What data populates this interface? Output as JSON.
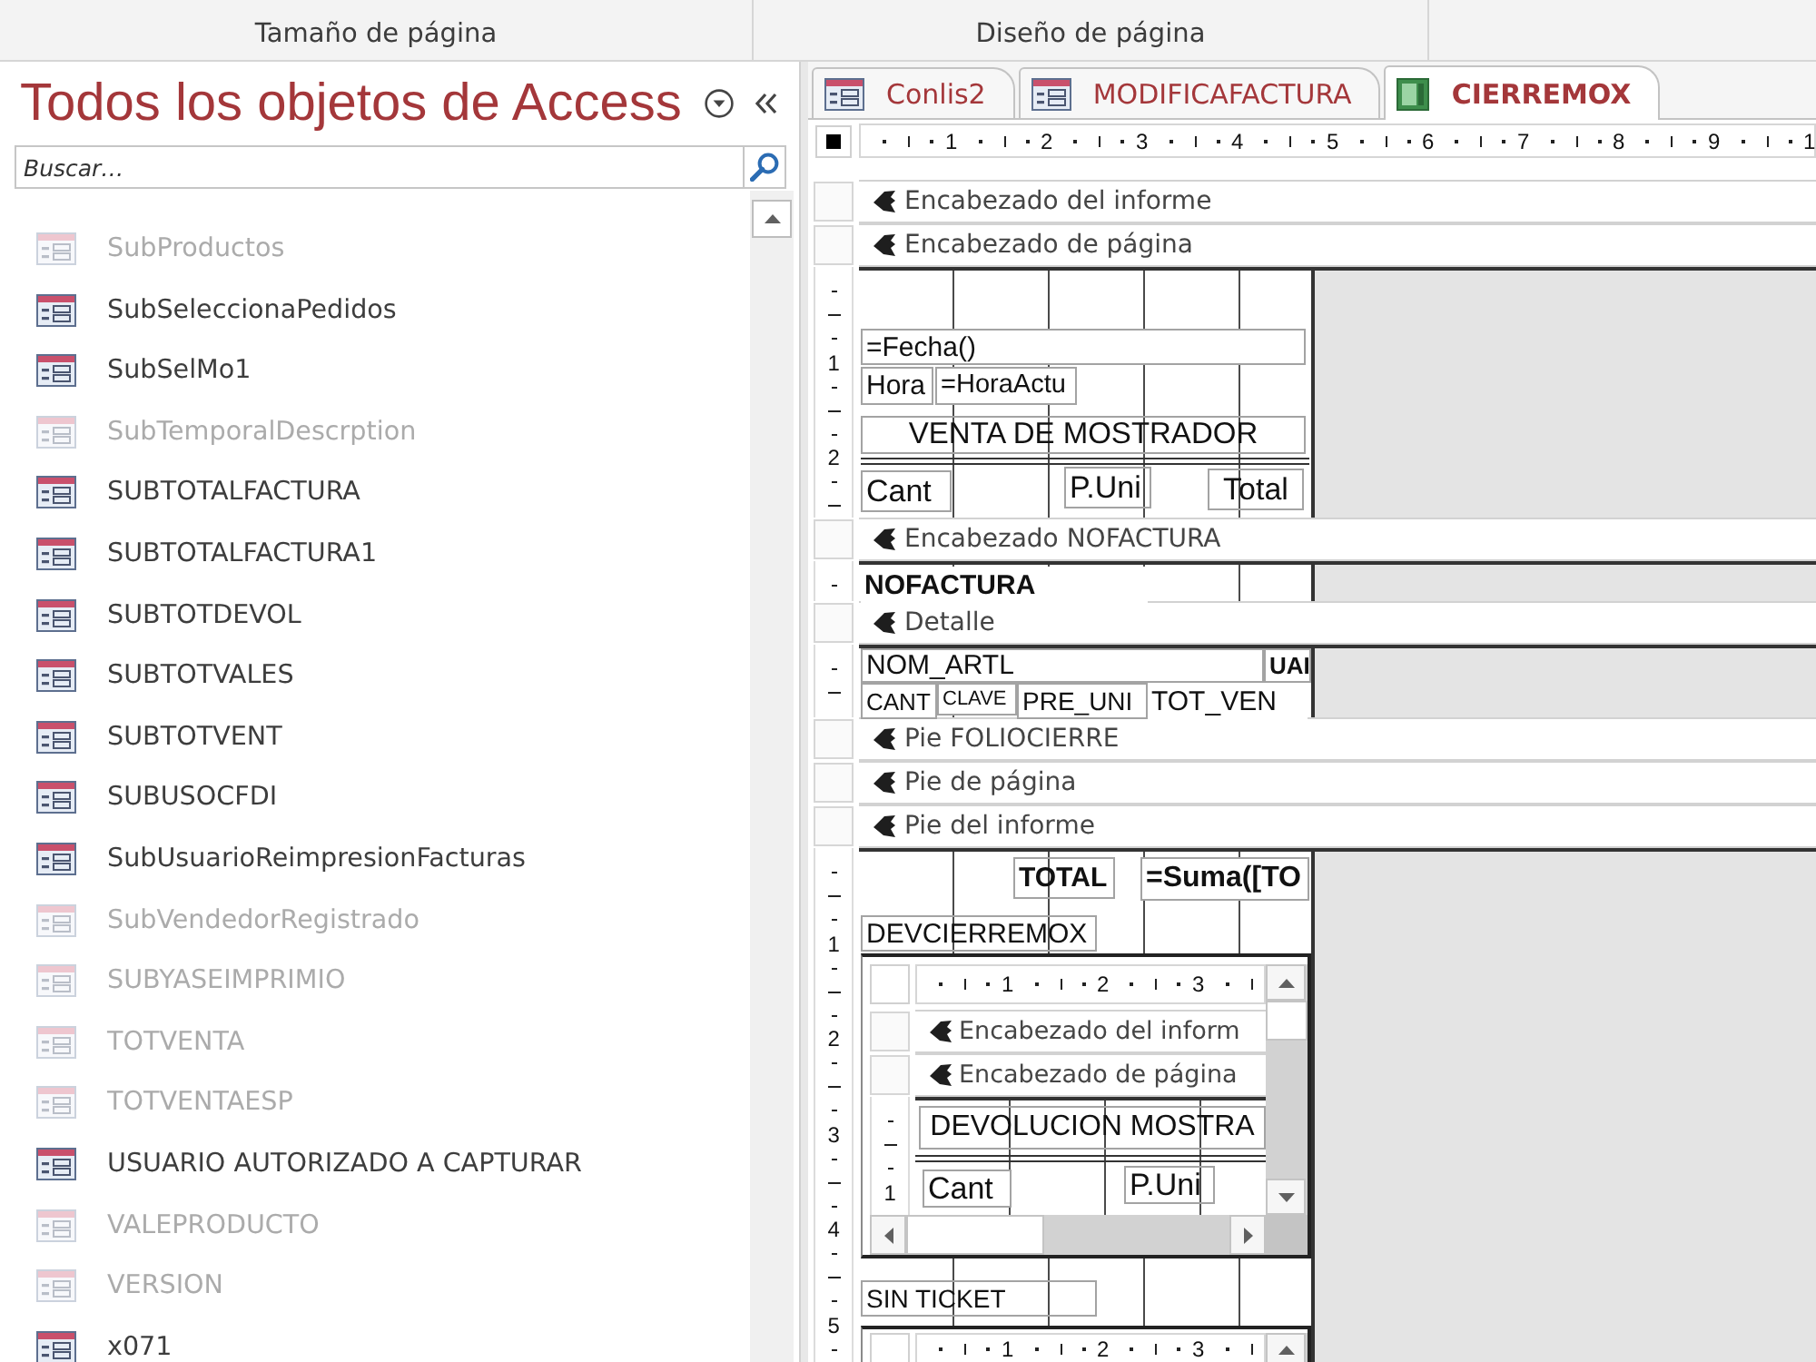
{
  "ribbon_groups": [
    {
      "label": "Tamaño de página"
    },
    {
      "label": "Diseño de página"
    }
  ],
  "navigation_pane": {
    "title": "Todos los objetos de Access",
    "search": {
      "placeholder": "Buscar…"
    },
    "items": [
      {
        "label": "SubProductos",
        "dimmed": true
      },
      {
        "label": "SubSeleccionaPedidos",
        "dimmed": false
      },
      {
        "label": "SubSelMo1",
        "dimmed": false
      },
      {
        "label": "SubTemporalDescrption",
        "dimmed": true
      },
      {
        "label": "SUBTOTALFACTURA",
        "dimmed": false
      },
      {
        "label": "SUBTOTALFACTURA1",
        "dimmed": false
      },
      {
        "label": "SUBTOTDEVOL",
        "dimmed": false
      },
      {
        "label": "SUBTOTVALES",
        "dimmed": false
      },
      {
        "label": "SUBTOTVENT",
        "dimmed": false
      },
      {
        "label": "SUBUSOCFDI",
        "dimmed": false
      },
      {
        "label": "SubUsuarioReimpresionFacturas",
        "dimmed": false
      },
      {
        "label": "SubVendedorRegistrado",
        "dimmed": true
      },
      {
        "label": "SUBYASEIMPRIMIO",
        "dimmed": true
      },
      {
        "label": "TOTVENTA",
        "dimmed": true
      },
      {
        "label": "TOTVENTAESP",
        "dimmed": true
      },
      {
        "label": "USUARIO AUTORIZADO A CAPTURAR",
        "dimmed": false
      },
      {
        "label": "VALEPRODUCTO",
        "dimmed": true
      },
      {
        "label": "VERSION",
        "dimmed": true
      },
      {
        "label": "x071",
        "dimmed": false
      }
    ]
  },
  "document_tabs": [
    {
      "label": "Conlis2",
      "kind": "form",
      "selected": false
    },
    {
      "label": "MODIFICAFACTURA",
      "kind": "form",
      "selected": false
    },
    {
      "label": "CIERREMOX",
      "kind": "report",
      "selected": true
    }
  ],
  "report": {
    "ruler": [
      "1",
      "2",
      "3",
      "4",
      "5",
      "6",
      "7",
      "8",
      "9",
      "1"
    ],
    "sections": [
      {
        "band": "Encabezado del informe"
      },
      {
        "band": "Encabezado de página",
        "ruler": [
          "1",
          "2"
        ],
        "controls": [
          {
            "kind": "text",
            "text": "=Fecha()"
          },
          {
            "kind": "text",
            "text": "Hora"
          },
          {
            "kind": "text",
            "text": "=HoraActu"
          },
          {
            "kind": "text",
            "text": "VENTA DE MOSTRADOR"
          },
          {
            "kind": "line"
          },
          {
            "kind": "text",
            "text": "Cant"
          },
          {
            "kind": "text",
            "text": "P.Uni"
          },
          {
            "kind": "text",
            "text": "Total"
          }
        ]
      },
      {
        "band": "Encabezado NOFACTURA",
        "controls": [
          {
            "kind": "text",
            "text": "NOFACTURA"
          }
        ]
      },
      {
        "band": "Detalle",
        "controls": [
          {
            "kind": "text",
            "text": "NOM_ARTL"
          },
          {
            "kind": "text",
            "text": "UAI"
          },
          {
            "kind": "text",
            "text": "CANT"
          },
          {
            "kind": "text",
            "text": "CLAVE"
          },
          {
            "kind": "text",
            "text": "PRE_UNI"
          },
          {
            "kind": "text",
            "text": "TOT_VEN"
          }
        ]
      },
      {
        "band": "Pie FOLIOCIERRE"
      },
      {
        "band": "Pie de página"
      },
      {
        "band": "Pie del informe",
        "ruler": [
          "1",
          "2",
          "3",
          "4",
          "5"
        ],
        "controls": [
          {
            "kind": "text",
            "text": "TOTAL"
          },
          {
            "kind": "text",
            "text": "=Suma([TO"
          },
          {
            "kind": "text",
            "text": "DEVCIERREMOX"
          },
          {
            "kind": "subreport",
            "ruler": [
              "1",
              "2",
              "3"
            ],
            "sections": [
              {
                "band": "Encabezado del inform"
              },
              {
                "band": "Encabezado de página",
                "ruler": [
                  "1"
                ],
                "controls": [
                  {
                    "kind": "text",
                    "text": "DEVOLUCION MOSTRA"
                  },
                  {
                    "kind": "line"
                  },
                  {
                    "kind": "text",
                    "text": "Cant"
                  },
                  {
                    "kind": "text",
                    "text": "P.Uni"
                  }
                ]
              }
            ]
          },
          {
            "kind": "text",
            "text": "SIN TICKET"
          },
          {
            "kind": "subreport",
            "ruler": [
              "1",
              "2",
              "3"
            ]
          }
        ]
      }
    ]
  }
}
